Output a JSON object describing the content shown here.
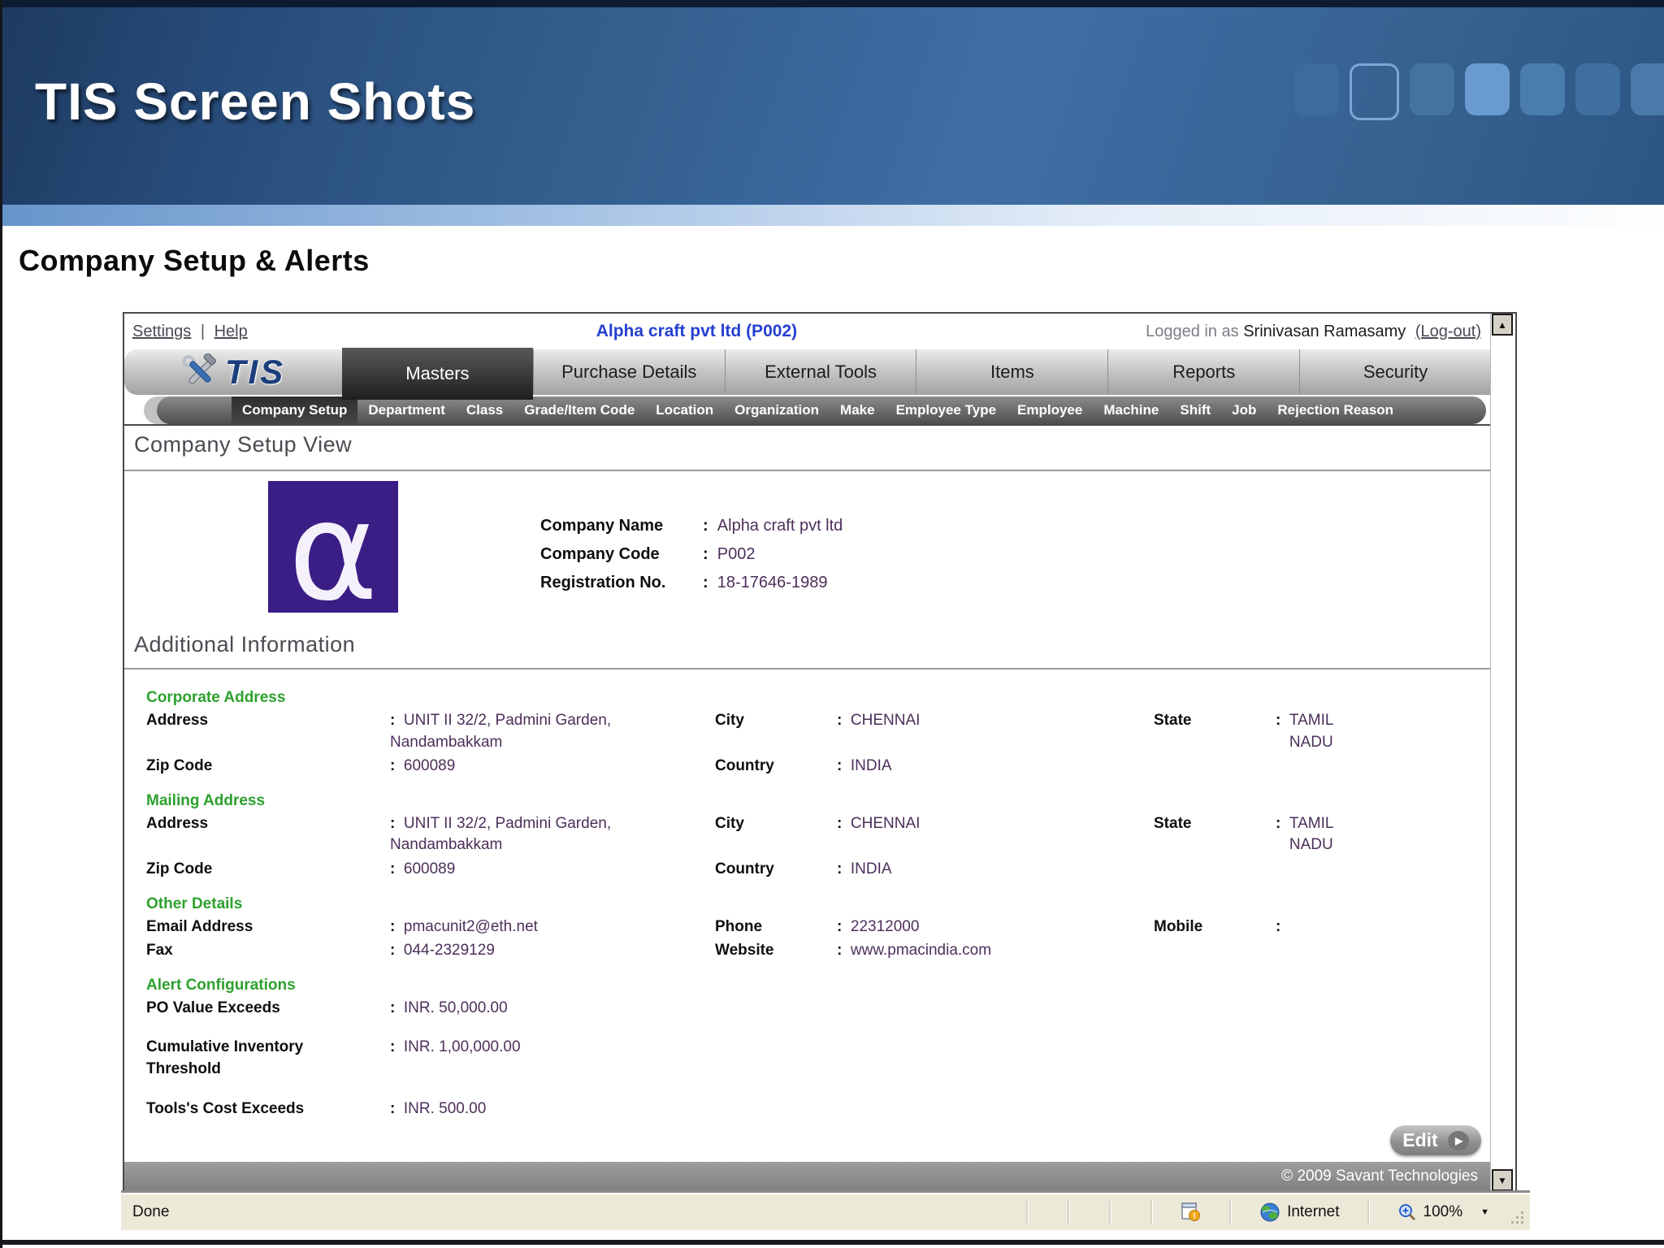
{
  "slide": {
    "title": "TIS Screen Shots",
    "subtitle": "Company Setup & Alerts"
  },
  "colors": {
    "header_blue": "#35618f",
    "title_link_blue": "#2540cf",
    "section_green": "#2da12d",
    "value_purple": "#4c2f5a",
    "active_tab_dark": "#2b2b2b",
    "logo_purple": "#3b1d86",
    "footer_gray": "#8b8b8b",
    "status_beige": "#ece9d8"
  },
  "icons": {
    "scroll_up": "▲",
    "scroll_down": "▼",
    "edit_arrow": "▶",
    "dropdown_caret": "▼"
  },
  "window": {
    "menu": {
      "settings": "Settings",
      "divider": "|",
      "help": "Help"
    },
    "title": "Alpha craft pvt ltd (P002)",
    "logged_in_prefix": "Logged in as",
    "user": "Srinivasan Ramasamy",
    "logout": "(Log-out)",
    "brand": "TIS",
    "tabs": [
      "Masters",
      "Purchase Details",
      "External Tools",
      "Items",
      "Reports",
      "Security"
    ],
    "active_tab": "Masters",
    "subnav": [
      "Company Setup",
      "Department",
      "Class",
      "Grade/Item Code",
      "Location",
      "Organization",
      "Make",
      "Employee Type",
      "Employee",
      "Machine",
      "Shift",
      "Job",
      "Rejection Reason"
    ],
    "active_subnav": "Company Setup"
  },
  "view": {
    "heading": "Company Setup View",
    "logo_char": "α",
    "fields": [
      {
        "label": "Company Name",
        "value": "Alpha craft pvt ltd"
      },
      {
        "label": "Company Code",
        "value": "P002"
      },
      {
        "label": "Registration No.",
        "value": "18-17646-1989"
      }
    ]
  },
  "additional": {
    "heading": "Additional Information",
    "rows": [
      {
        "type": "section",
        "title": "Corporate Address"
      },
      {
        "type": "fields",
        "f": [
          {
            "l": "Address",
            "v": "UNIT II 32/2, Padmini Garden, Nandambakkam"
          },
          {
            "l": "City",
            "v": "CHENNAI"
          },
          {
            "l": "State",
            "v": "TAMIL NADU"
          }
        ]
      },
      {
        "type": "fields",
        "f": [
          {
            "l": "Zip Code",
            "v": "600089"
          },
          {
            "l": "Country",
            "v": "INDIA"
          }
        ]
      },
      {
        "type": "section",
        "title": "Mailing Address"
      },
      {
        "type": "fields",
        "f": [
          {
            "l": "Address",
            "v": "UNIT II 32/2, Padmini Garden, Nandambakkam"
          },
          {
            "l": "City",
            "v": "CHENNAI"
          },
          {
            "l": "State",
            "v": "TAMIL NADU"
          }
        ]
      },
      {
        "type": "fields",
        "f": [
          {
            "l": "Zip Code",
            "v": "600089"
          },
          {
            "l": "Country",
            "v": "INDIA"
          }
        ]
      },
      {
        "type": "section",
        "title": "Other Details"
      },
      {
        "type": "fields",
        "f": [
          {
            "l": "Email Address",
            "v": "pmacunit2@eth.net"
          },
          {
            "l": "Phone",
            "v": "22312000"
          },
          {
            "l": "Mobile",
            "v": ""
          }
        ]
      },
      {
        "type": "fields",
        "f": [
          {
            "l": "Fax",
            "v": "044-2329129"
          },
          {
            "l": "Website",
            "v": "www.pmacindia.com"
          }
        ]
      },
      {
        "type": "section",
        "title": "Alert Configurations"
      },
      {
        "type": "fields",
        "f": [
          {
            "l": "PO Value Exceeds",
            "v": "INR. 50,000.00"
          }
        ]
      },
      {
        "type": "fields",
        "f": [
          {
            "l": "Cumulative Inventory Threshold",
            "v": "INR. 1,00,000.00"
          }
        ]
      },
      {
        "type": "fields",
        "f": [
          {
            "l": "Tools's Cost Exceeds",
            "v": "INR. 500.00"
          }
        ]
      }
    ]
  },
  "edit_button": "Edit",
  "footer": {
    "copyright": "© 2009 Savant Technologies"
  },
  "status_bar": {
    "status": "Done",
    "zone": "Internet",
    "zoom": "100%"
  }
}
